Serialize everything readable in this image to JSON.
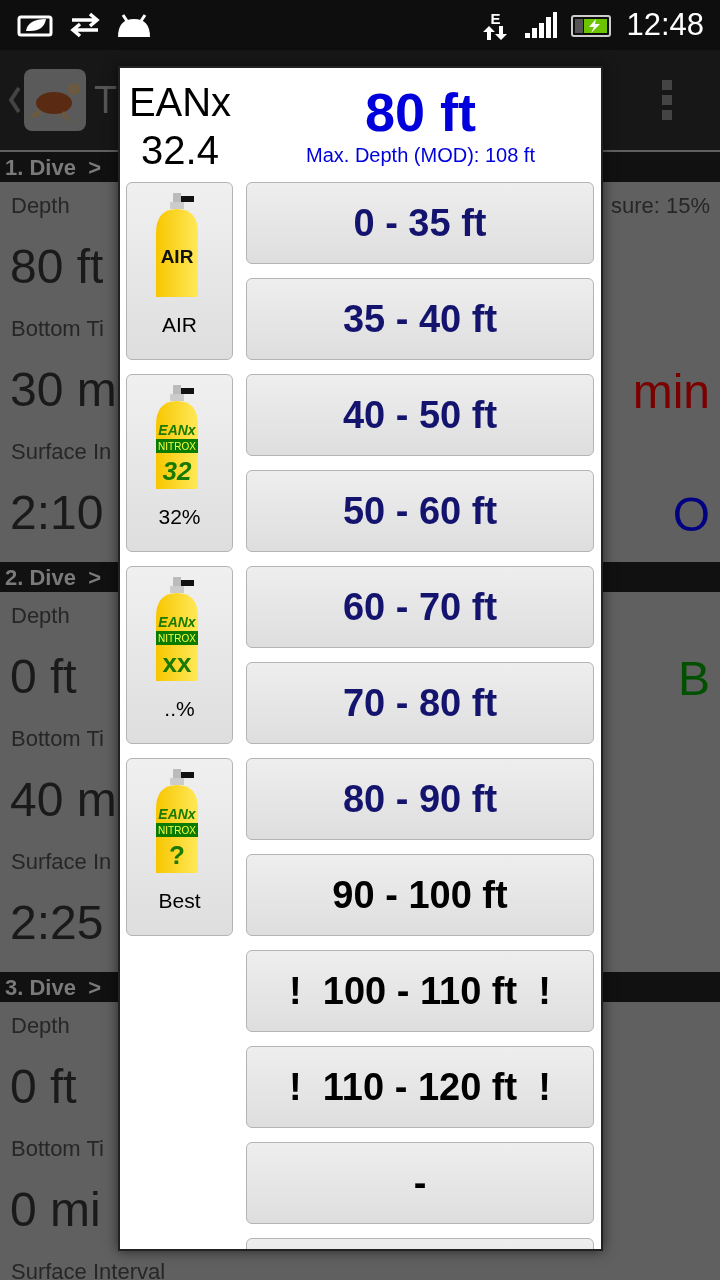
{
  "status_bar": {
    "time": "12:48",
    "network": "E"
  },
  "app_bar": {
    "title": "T"
  },
  "dives": [
    {
      "header": "1. Dive  >",
      "fields": [
        {
          "label": "Depth",
          "value": "80 ft",
          "side_label": "sure: 15%"
        },
        {
          "label": "Bottom Ti",
          "value": "30 m",
          "side_value": "min",
          "color": "#7a0000"
        },
        {
          "label": "Surface In",
          "value": "2:10",
          "side_value": "O",
          "color": "#000080"
        }
      ]
    },
    {
      "header": "2. Dive  >",
      "fields": [
        {
          "label": "Depth",
          "value": "0 ft",
          "side_value": "B",
          "color": "#005000"
        },
        {
          "label": "Bottom Ti",
          "value": "40 m"
        },
        {
          "label": "Surface In",
          "value": "2:25"
        }
      ]
    },
    {
      "header": "3. Dive  >",
      "fields": [
        {
          "label": "Depth",
          "value": "0 ft"
        },
        {
          "label": "Bottom Ti",
          "value": "0 mi"
        },
        {
          "label": "Surface Interval"
        }
      ]
    }
  ],
  "dialog": {
    "gas": "EANx",
    "fraction": "32.4",
    "depth": "80 ft",
    "mod": "Max. Depth (MOD): 108 ft",
    "tanks": [
      {
        "kind": "air",
        "mark": "AIR",
        "label": "AIR"
      },
      {
        "kind": "nitrox",
        "brand": "EANx",
        "band": "NITROX",
        "mark": "32",
        "label": "32%"
      },
      {
        "kind": "nitrox",
        "brand": "EANx",
        "band": "NITROX",
        "mark": "xx",
        "label": "..%"
      },
      {
        "kind": "nitrox",
        "brand": "EANx",
        "band": "NITROX",
        "mark": "?",
        "label": "Best"
      }
    ],
    "ranges": [
      {
        "kind": "range",
        "label": "0 - 35 ft",
        "color": "#14146e"
      },
      {
        "kind": "range",
        "label": "35 - 40 ft",
        "color": "#14146e"
      },
      {
        "kind": "range",
        "label": "40 - 50 ft",
        "color": "#14146e"
      },
      {
        "kind": "range",
        "label": "50 - 60 ft",
        "color": "#14146e"
      },
      {
        "kind": "range",
        "label": "60 - 70 ft",
        "color": "#14146e"
      },
      {
        "kind": "range",
        "label": "70 - 80 ft",
        "color": "#14146e"
      },
      {
        "kind": "range",
        "label": "80 - 90 ft",
        "color": "#14146e"
      },
      {
        "kind": "range",
        "label": "90 - 100 ft",
        "color": "#000000"
      },
      {
        "kind": "range",
        "label": "!  100 - 110 ft  !",
        "color": "#000000"
      },
      {
        "kind": "range",
        "label": "!  110 - 120 ft  !",
        "color": "#000000"
      },
      {
        "kind": "range",
        "label": "-",
        "color": "#000000"
      },
      {
        "kind": "partial"
      }
    ]
  }
}
